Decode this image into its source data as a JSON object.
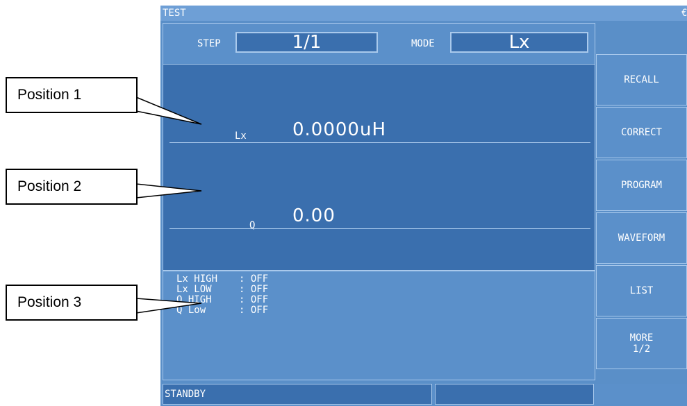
{
  "window": {
    "title": "TEST",
    "corner_glyph": "€"
  },
  "header": {
    "step_label": "STEP",
    "step_value": "1/1",
    "mode_label": "MODE",
    "mode_value": "Lx"
  },
  "measurements": {
    "primary": {
      "param": "Lx",
      "value": "0.0000uH"
    },
    "secondary": {
      "param": "Q",
      "value": "0.00"
    }
  },
  "limits": [
    {
      "name": "Lx HIGH",
      "value": ": OFF"
    },
    {
      "name": "Lx LOW",
      "value": ": OFF"
    },
    {
      "name": "Q HIGH",
      "value": ": OFF"
    },
    {
      "name": "Q Low",
      "value": ": OFF"
    }
  ],
  "status": {
    "text": "STANDBY",
    "extra": ""
  },
  "softkeys": [
    {
      "label": "RECALL"
    },
    {
      "label": "CORRECT"
    },
    {
      "label": "PROGRAM"
    },
    {
      "label": "WAVEFORM"
    },
    {
      "label": "LIST"
    },
    {
      "label": "MORE\n1/2"
    }
  ],
  "callouts": {
    "position1": "Position 1",
    "position2": "Position 2",
    "position3": "Position 3"
  },
  "colors": {
    "screen_background": "#5a8fc8",
    "display_area": "#3a6fae",
    "border": "#a9c9ec",
    "text": "#ffffff"
  }
}
